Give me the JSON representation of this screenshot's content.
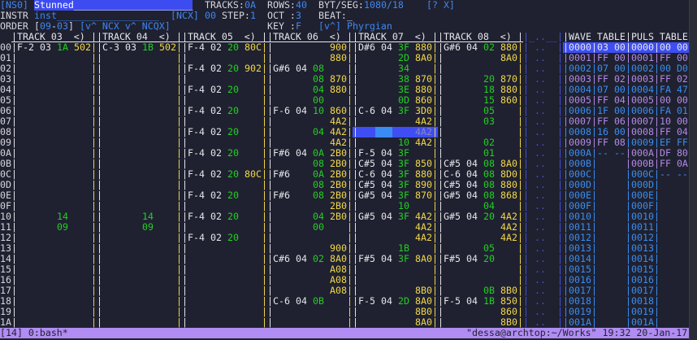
{
  "header": {
    "song_id": "[NS0]",
    "song_name": "Stunned_____________________",
    "tracks_label": "TRACKS:",
    "tracks_value": "0A",
    "rows_label": "ROWS:",
    "rows_value": "40",
    "bytseg_label": "BYT/SEG:",
    "bytseg_value": "1080/18",
    "help_close": "[? X]",
    "instr_label": "INSTR",
    "instr_name": "inst__________________",
    "instr_flags": "[NCX]",
    "instr_number": "00",
    "step_label": "STEP:",
    "step_value": "1",
    "oct_label": "OCT :",
    "oct_value": "3",
    "beat_label": "BEAT:",
    "beat_value": "_",
    "order_label": "ORDER",
    "order_open": "[",
    "order_start": "09",
    "order_dash": "-",
    "order_end": "03",
    "order_close": "]",
    "order_controls": "[v^ NCX v^ NCQX]",
    "key_label": "KEY :",
    "key_value": "F",
    "scale_control": "[v^]",
    "scale_value": "Phyrgian"
  },
  "colors": {
    "background": "#1f2130",
    "note": "#e6e6ea",
    "fx": "#22d022",
    "value": "#f2d84a",
    "accent": "#3f86f0",
    "alt_row": "#b28be6",
    "cursor": "#3e4ef2",
    "status_bar": "#b18cf2"
  },
  "row_labels": [
    "00",
    "01",
    "02",
    "03",
    "04",
    "05",
    "06",
    "07",
    "08",
    "09",
    "0A",
    "0B",
    "0C",
    "0D",
    "0E",
    "0F",
    "10",
    "11",
    "12",
    "13",
    "14",
    "15",
    "16",
    "17",
    "18",
    "19",
    "1A"
  ],
  "tracks": [
    {
      "header": "TRACK 03  <) ",
      "rows": {
        "00": [
          "F-2",
          "03",
          "1A",
          "502"
        ],
        "10": [
          "",
          "",
          "14",
          ""
        ],
        "11": [
          "",
          "",
          "09",
          ""
        ]
      }
    },
    {
      "header": "TRACK 04  <) ",
      "rows": {
        "00": [
          "C-3",
          "03",
          "1B",
          "502"
        ],
        "10": [
          "",
          "",
          "14",
          ""
        ],
        "11": [
          "",
          "",
          "09",
          ""
        ]
      }
    },
    {
      "header": "TRACK 05  <) ",
      "rows": {
        "00": [
          "F-4",
          "02",
          "20",
          "80C"
        ],
        "02": [
          "F-4",
          "02",
          "20",
          "902"
        ],
        "04": [
          "F-4",
          "02",
          "20",
          ""
        ],
        "06": [
          "F-4",
          "02",
          "20",
          ""
        ],
        "08": [
          "F-4",
          "02",
          "20",
          ""
        ],
        "0A": [
          "F-4",
          "02",
          "20",
          ""
        ],
        "0C": [
          "F-4",
          "02",
          "20",
          "80C"
        ],
        "0E": [
          "F-4",
          "02",
          "20",
          ""
        ],
        "10": [
          "F-4",
          "02",
          "20",
          ""
        ],
        "12": [
          "F-4",
          "02",
          "20",
          ""
        ]
      }
    },
    {
      "header": "TRACK 06  <) ",
      "rows": {
        "00": [
          "",
          "",
          "",
          "900"
        ],
        "01": [
          "",
          "",
          "",
          "880"
        ],
        "02": [
          "G#6",
          "04",
          "08",
          ""
        ],
        "03": [
          "",
          "",
          "08",
          "870"
        ],
        "04": [
          "",
          "",
          "04",
          "880"
        ],
        "05": [
          "",
          "",
          "00",
          ""
        ],
        "06": [
          "F-6",
          "04",
          "10",
          "860"
        ],
        "07": [
          "",
          "",
          "",
          "4A2"
        ],
        "08": [
          "",
          "",
          "04",
          "4A2"
        ],
        "09": [
          "",
          "",
          "",
          "4A2"
        ],
        "0A": [
          "F#6",
          "04",
          "0A",
          "2B0"
        ],
        "0B": [
          "",
          "",
          "08",
          "2B0"
        ],
        "0C": [
          "F#6",
          "",
          "0A",
          "2B0"
        ],
        "0D": [
          "",
          "",
          "08",
          "2B0"
        ],
        "0E": [
          "F#6",
          "",
          "08",
          "2B0"
        ],
        "0F": [
          "",
          "",
          "",
          "2B0"
        ],
        "10": [
          "",
          "",
          "04",
          "2B0"
        ],
        "11": [
          "",
          "",
          "00",
          ""
        ],
        "13": [
          "",
          "",
          "",
          "900"
        ],
        "14": [
          "C#6",
          "04",
          "02",
          "8A0"
        ],
        "15": [
          "",
          "",
          "",
          "A08"
        ],
        "16": [
          "",
          "",
          "",
          "A08"
        ],
        "17": [
          "",
          "",
          "",
          "A08"
        ],
        "18": [
          "C-6",
          "04",
          "0B",
          ""
        ]
      }
    },
    {
      "header": "TRACK 07  <) ",
      "rows": {
        "00": [
          "D#6",
          "04",
          "3F",
          "880"
        ],
        "01": [
          "",
          "",
          "2D",
          "8A0"
        ],
        "02": [
          "",
          "",
          "34",
          ""
        ],
        "03": [
          "",
          "",
          "38",
          "870"
        ],
        "04": [
          "",
          "",
          "3E",
          "880"
        ],
        "05": [
          "",
          "",
          "0D",
          "860"
        ],
        "06": [
          "C-6",
          "04",
          "3F",
          "3D0"
        ],
        "07": [
          "",
          "",
          "",
          "4A2"
        ],
        "08": [
          "",
          "",
          "",
          "4A2"
        ],
        "09": [
          "",
          "",
          "10",
          "4A2"
        ],
        "0A": [
          "F-5",
          "04",
          "3F",
          ""
        ],
        "0B": [
          "C#5",
          "04",
          "3F",
          "850"
        ],
        "0C": [
          "C-6",
          "04",
          "3F",
          "880"
        ],
        "0D": [
          "C#5",
          "04",
          "3F",
          "890"
        ],
        "0E": [
          "G#5",
          "04",
          "3F",
          "870"
        ],
        "0F": [
          "",
          "",
          "10",
          ""
        ],
        "10": [
          "G#5",
          "04",
          "3F",
          "4A2"
        ],
        "11": [
          "",
          "",
          "",
          "4A2"
        ],
        "12": [
          "",
          "",
          "",
          "4A2"
        ],
        "13": [
          "",
          "",
          "1B",
          ""
        ],
        "14": [
          "F#5",
          "04",
          "3F",
          "8A0"
        ],
        "17": [
          "",
          "",
          "",
          "8B0"
        ],
        "18": [
          "F-5",
          "04",
          "2D",
          "8A0"
        ],
        "19": [
          "",
          "",
          "",
          "8B0"
        ],
        "1A": [
          "",
          "",
          "",
          "8A0"
        ]
      }
    },
    {
      "header": "TRACK 08  <) ",
      "rows": {
        "00": [
          "G#6",
          "04",
          "02",
          "880"
        ],
        "01": [
          "",
          "",
          "",
          "8A0"
        ],
        "03": [
          "",
          "",
          "20",
          "870"
        ],
        "04": [
          "",
          "",
          "18",
          "880"
        ],
        "05": [
          "",
          "",
          "15",
          "860"
        ],
        "06": [
          "",
          "",
          "05",
          ""
        ],
        "07": [
          "",
          "",
          "03",
          ""
        ],
        "09": [
          "",
          "",
          "02",
          ""
        ],
        "0A": [
          "",
          "",
          "01",
          ""
        ],
        "0B": [
          "C#5",
          "04",
          "08",
          "8A0"
        ],
        "0C": [
          "C-6",
          "04",
          "08",
          "8D0"
        ],
        "0D": [
          "C#5",
          "04",
          "08",
          "880"
        ],
        "0E": [
          "G#5",
          "04",
          "08",
          "868"
        ],
        "0F": [
          "",
          "",
          "04",
          ""
        ],
        "10": [
          "G#5",
          "04",
          "20",
          "4A2"
        ],
        "11": [
          "",
          "",
          "",
          "4A2"
        ],
        "12": [
          "",
          "",
          "",
          "4A2"
        ],
        "13": [
          "",
          "",
          "05",
          ""
        ],
        "14": [
          "F#5",
          "04",
          "20",
          ""
        ],
        "17": [
          "",
          "",
          "0B",
          "8B0"
        ],
        "18": [
          "F-5",
          "04",
          "1B",
          "850"
        ],
        "19": [
          "",
          "",
          "",
          "860"
        ],
        "1A": [
          "",
          "",
          "",
          "8B0"
        ]
      }
    }
  ],
  "cursor": {
    "row": "08",
    "track": 4
  },
  "extra_column": {
    "header": "_..__",
    "cell": ".."
  },
  "wave_table": {
    "title": "WAVE TABLE",
    "selected": "0000",
    "entries": [
      [
        "0000",
        "03 00",
        false
      ],
      [
        "0001",
        "FF 00",
        true
      ],
      [
        "0002",
        "07 00",
        false
      ],
      [
        "0003",
        "FF 02",
        true
      ],
      [
        "0004",
        "07 00",
        false
      ],
      [
        "0005",
        "FF 04",
        true
      ],
      [
        "0006",
        "1F 00",
        false
      ],
      [
        "0007",
        "FF 06",
        true
      ],
      [
        "0008",
        "16 00",
        false
      ],
      [
        "0009",
        "FF 08",
        true
      ],
      [
        "000A",
        "-- --",
        false
      ]
    ]
  },
  "pulse_table": {
    "title": "PULS TABLE",
    "entries": [
      [
        "0000",
        "00 00",
        false
      ],
      [
        "0001",
        "FF 00",
        true
      ],
      [
        "0002",
        "00 D0",
        false
      ],
      [
        "0003",
        "FF 02",
        true
      ],
      [
        "0004",
        "FA 47",
        false
      ],
      [
        "0005",
        "00 00",
        true
      ],
      [
        "0006",
        "FA 01",
        false
      ],
      [
        "0007",
        "10 00",
        true
      ],
      [
        "0008",
        "FF 04",
        true
      ],
      [
        "0009",
        "EF FF",
        false
      ],
      [
        "000A",
        "DF 80",
        true
      ],
      [
        "000B",
        "FF 0A",
        true
      ],
      [
        "000C",
        "-- --",
        false
      ]
    ]
  },
  "table_indices": [
    "0000",
    "0001",
    "0002",
    "0003",
    "0004",
    "0005",
    "0006",
    "0007",
    "0008",
    "0009",
    "000A",
    "000B",
    "000C",
    "000D",
    "000E",
    "000F",
    "0010",
    "0011",
    "0012",
    "0013",
    "0014",
    "0015",
    "0016",
    "0017",
    "0018",
    "0019",
    "001A"
  ],
  "status_bar": {
    "left": "[14] 0:bash*",
    "right": "\"dessa@archtop:~/Works\" 19:32 20-Jan-17"
  }
}
